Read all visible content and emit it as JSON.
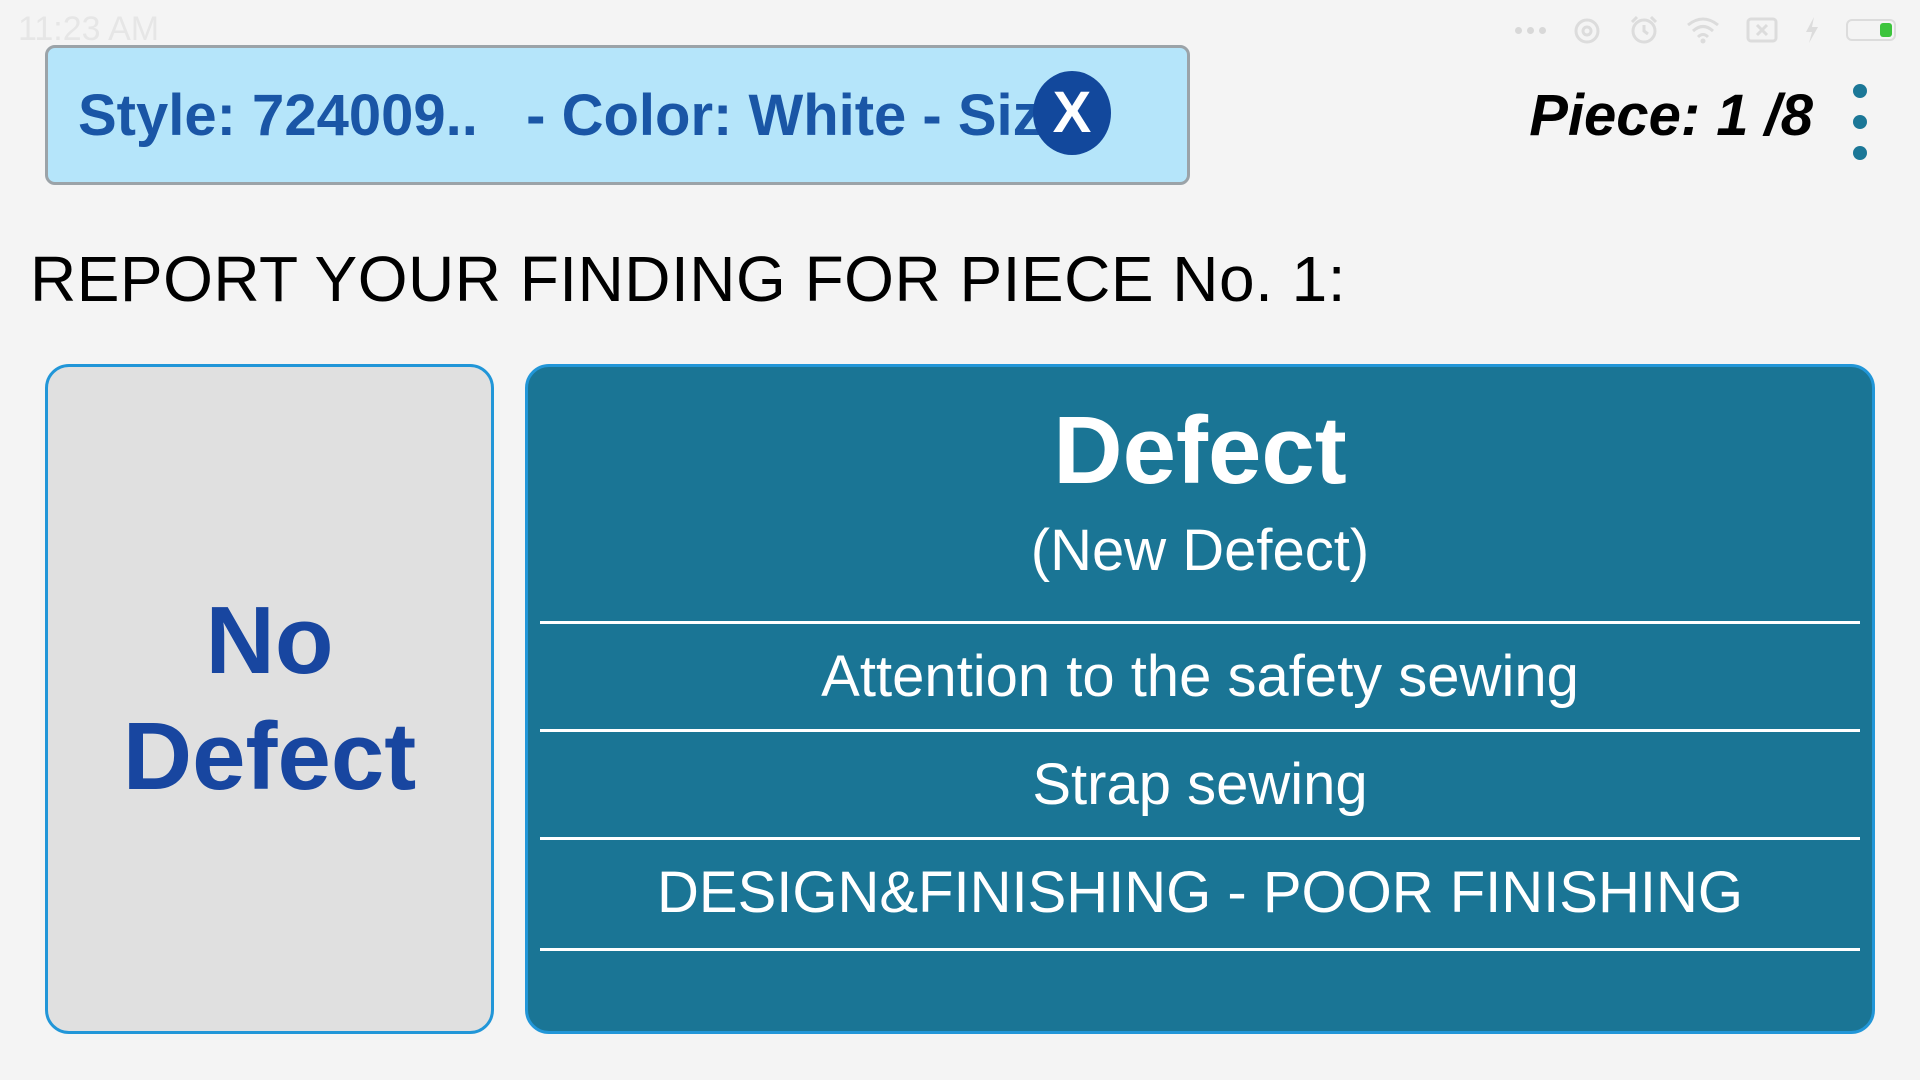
{
  "status_bar": {
    "time": "11:23 AM",
    "icons": [
      "more-dots-icon",
      "alarm-icon",
      "alarm-clock-icon",
      "wifi-icon",
      "sim-icon",
      "charging-icon",
      "battery-icon"
    ],
    "battery_color": "#3cc43c"
  },
  "header": {
    "info_text": "Style: 724009..   - Color: White - Size:",
    "close_label": "X",
    "piece_counter": "Piece: 1 /8",
    "menu_icon": "more-vert-icon"
  },
  "prompt": "REPORT YOUR FINDING FOR PIECE No. 1:",
  "no_defect": {
    "line1": "No",
    "line2": "Defect"
  },
  "defect": {
    "title": "Defect",
    "new_defect": "(New Defect)",
    "items": [
      "Attention to the safety sewing",
      "Strap sewing",
      "DESIGN&FINISHING - POOR FINISHING"
    ]
  },
  "colors": {
    "info_bg": "#b5e5fa",
    "info_text": "#1a56a6",
    "close_bg": "#12489c",
    "defect_bg": "#1a7595",
    "no_defect_bg": "#e0e0e0",
    "no_defect_text": "#1846a0",
    "accent_border": "#2196d8"
  }
}
